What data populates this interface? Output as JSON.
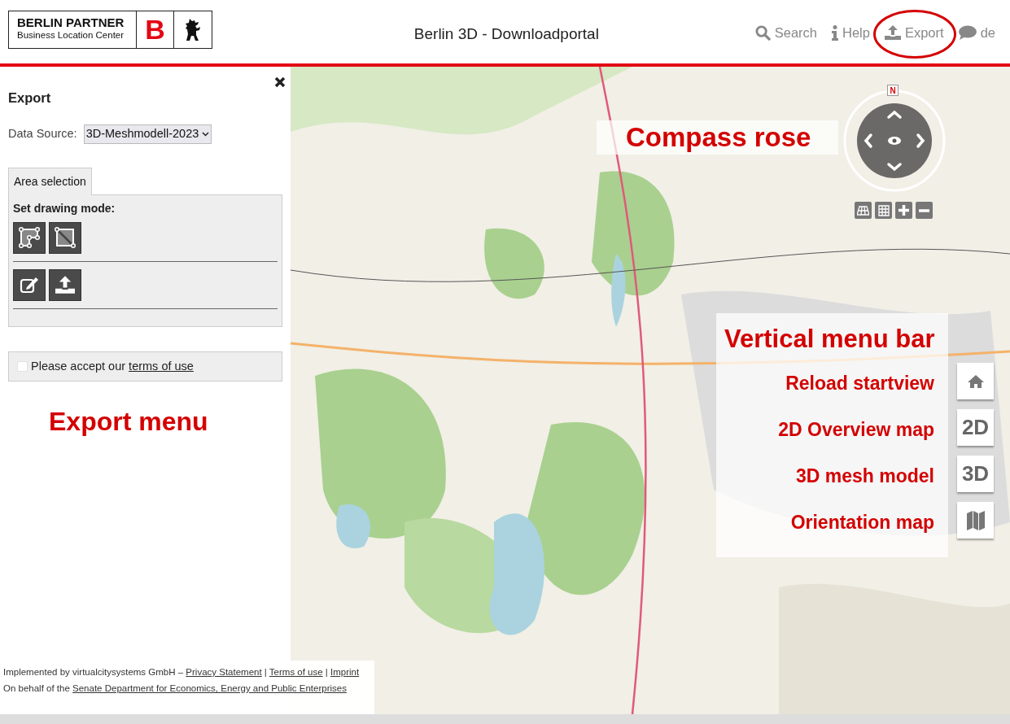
{
  "header": {
    "logo": {
      "title": "BERLIN PARTNER",
      "subtitle": "Business Location Center",
      "letter": "B"
    },
    "title": "Berlin 3D - Downloadportal",
    "nav": [
      {
        "label": "Search",
        "kind": "search",
        "circled": false
      },
      {
        "label": "Help",
        "kind": "info",
        "circled": false
      },
      {
        "label": "Export",
        "kind": "upload",
        "circled": true
      },
      {
        "label": "de",
        "kind": "chat",
        "circled": false
      }
    ]
  },
  "export_panel": {
    "title": "Export",
    "data_source_label": "Data Source:",
    "data_source_value": "3D-Meshmodell-2023",
    "tabs": [
      {
        "label": "Area selection",
        "selected": true
      }
    ],
    "drawing_mode_label": "Set drawing mode:",
    "terms": {
      "checked": false,
      "text": "Please accept our",
      "link": "terms of use"
    },
    "annotation": "Export menu"
  },
  "map": {
    "compass": {
      "north": "N",
      "annotation": "Compass rose"
    },
    "menu_title": "Vertical menu bar",
    "menu_bar": [
      {
        "kind": "home",
        "annotation": "Reload startview"
      },
      {
        "kind": "text",
        "label": "2D",
        "annotation": "2D Overview map"
      },
      {
        "kind": "text",
        "label": "3D",
        "annotation": "3D mesh model"
      },
      {
        "kind": "map",
        "annotation": "Orientation map"
      }
    ]
  },
  "footer": [
    {
      "text": "Implemented by virtualcitysystems GmbH –",
      "links": [
        "Privacy Statement",
        "Terms of use",
        "Imprint"
      ],
      "separator": "|"
    },
    {
      "text": "On behalf of the",
      "links": [
        "Senate Department for Economics, Energy and Public Enterprises"
      ]
    }
  ]
}
